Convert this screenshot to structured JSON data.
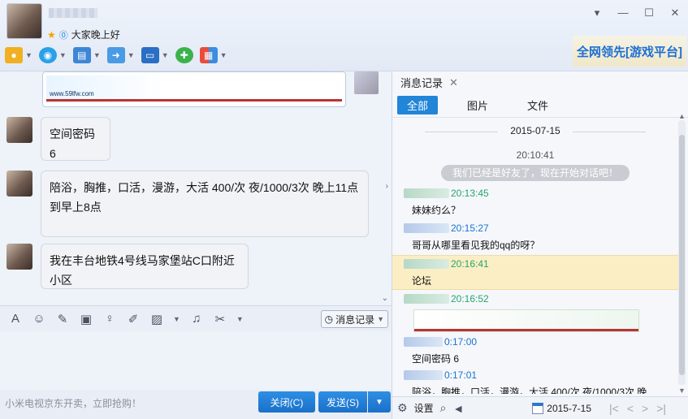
{
  "window": {
    "status_text": "大家晚上好",
    "controls": [
      "▾",
      "—",
      "☐",
      "✕"
    ]
  },
  "toolbar": {
    "items": [
      {
        "name": "voice",
        "icon": "mic-icon",
        "glyph": "🎙"
      },
      {
        "name": "video",
        "icon": "camera-icon",
        "glyph": "◉"
      },
      {
        "name": "screen-share",
        "icon": "monitor-icon",
        "glyph": "▤"
      },
      {
        "name": "file-transfer",
        "icon": "folder-icon",
        "glyph": "➜"
      },
      {
        "name": "remote",
        "icon": "remote-desktop-icon",
        "glyph": "▭"
      },
      {
        "name": "add-chat",
        "icon": "chat-plus-icon",
        "glyph": "✚"
      },
      {
        "name": "apps",
        "icon": "apps-grid-icon",
        "glyph": "▦"
      }
    ]
  },
  "banner": {
    "text": "全网领先[游戏平台]"
  },
  "ad": {
    "url": "www.59lfw.com"
  },
  "chat": {
    "messages": [
      {
        "text": "空间密码  6"
      },
      {
        "text": "陪浴，胸推，口活，漫游，大活 400/次 夜/1000/3次 晚上11点到早上8点"
      },
      {
        "text": "我在丰台地铁4号线马家堡站C口附近小区"
      }
    ]
  },
  "input_tools": {
    "history_label": "消息记录"
  },
  "footer": {
    "promo": "小米电视京东开卖，立即抢购！",
    "close_label": "关闭(C)",
    "send_label": "发送(S)"
  },
  "history": {
    "tab_label": "消息记录",
    "filters": [
      "全部",
      "图片",
      "文件"
    ],
    "date": "2015-07-15",
    "system_time": "20:10:41",
    "system_msg": "我们已经是好友了，现在开始对话吧！",
    "entries": [
      {
        "time": "20:13:45",
        "text": "妹妹约么？",
        "color": "green"
      },
      {
        "time": "20:15:27",
        "text": "哥哥从哪里看见我的qq的呀？",
        "color": "blue"
      },
      {
        "time": "20:16:41",
        "text": "论坛",
        "color": "green"
      },
      {
        "time": "20:16:52",
        "text": "",
        "color": "green"
      },
      {
        "time": "0:17:00",
        "text": "空间密码  6",
        "color": "blue"
      },
      {
        "time": "0:17:01",
        "text": "陪浴，胸推，口活，漫游，大活 400/次 夜/1000/3次 晚",
        "color": "blue"
      }
    ],
    "settings_label": "设置",
    "bottom_date": "2015-7-15"
  },
  "colors": {
    "accent": "#2185d8",
    "highlight": "#fbeec4",
    "green_name": "#26a66b",
    "blue_name": "#1d72d1"
  }
}
